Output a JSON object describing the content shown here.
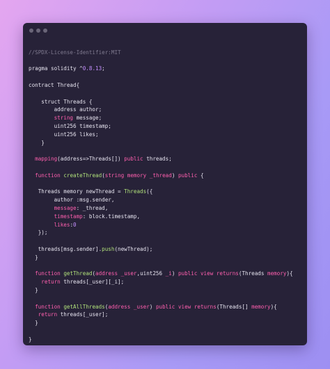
{
  "window": {
    "controls": [
      "close",
      "minimize",
      "maximize"
    ]
  },
  "code": {
    "lines": [
      [
        {
          "t": "",
          "c": "plain"
        }
      ],
      [
        {
          "t": "//SPDX-License-Identifier:MIT",
          "c": "comment"
        }
      ],
      [
        {
          "t": "",
          "c": "plain"
        }
      ],
      [
        {
          "t": "pragma solidity ^",
          "c": "plain"
        },
        {
          "t": "0.8.13",
          "c": "num"
        },
        {
          "t": ";",
          "c": "plain"
        }
      ],
      [
        {
          "t": "",
          "c": "plain"
        }
      ],
      [
        {
          "t": "contract Thread{",
          "c": "plain"
        }
      ],
      [
        {
          "t": "",
          "c": "plain"
        }
      ],
      [
        {
          "t": "    struct Threads {",
          "c": "plain"
        }
      ],
      [
        {
          "t": "        address author;",
          "c": "plain"
        }
      ],
      [
        {
          "t": "        ",
          "c": "plain"
        },
        {
          "t": "string",
          "c": "pink"
        },
        {
          "t": " message;",
          "c": "plain"
        }
      ],
      [
        {
          "t": "        uint256 timestamp;",
          "c": "plain"
        }
      ],
      [
        {
          "t": "        uint256 likes;",
          "c": "plain"
        }
      ],
      [
        {
          "t": "    }",
          "c": "plain"
        }
      ],
      [
        {
          "t": "",
          "c": "plain"
        }
      ],
      [
        {
          "t": "  ",
          "c": "plain"
        },
        {
          "t": "mapping",
          "c": "pink"
        },
        {
          "t": "(address=>Threads[]) ",
          "c": "plain"
        },
        {
          "t": "public",
          "c": "pink"
        },
        {
          "t": " threads;",
          "c": "plain"
        }
      ],
      [
        {
          "t": "",
          "c": "plain"
        }
      ],
      [
        {
          "t": "  ",
          "c": "plain"
        },
        {
          "t": "function",
          "c": "pink"
        },
        {
          "t": " ",
          "c": "plain"
        },
        {
          "t": "createThread",
          "c": "fn"
        },
        {
          "t": "(",
          "c": "plain"
        },
        {
          "t": "string",
          "c": "pink"
        },
        {
          "t": " ",
          "c": "plain"
        },
        {
          "t": "memory",
          "c": "pink"
        },
        {
          "t": " ",
          "c": "plain"
        },
        {
          "t": "_thread",
          "c": "pink"
        },
        {
          "t": ") ",
          "c": "plain"
        },
        {
          "t": "public",
          "c": "pink"
        },
        {
          "t": " {",
          "c": "plain"
        }
      ],
      [
        {
          "t": "",
          "c": "plain"
        }
      ],
      [
        {
          "t": "   Threads memory newThread = ",
          "c": "plain"
        },
        {
          "t": "Threads",
          "c": "fn"
        },
        {
          "t": "({",
          "c": "plain"
        }
      ],
      [
        {
          "t": "        author :msg.sender,",
          "c": "plain"
        }
      ],
      [
        {
          "t": "        ",
          "c": "plain"
        },
        {
          "t": "message",
          "c": "pink"
        },
        {
          "t": ": _thread,",
          "c": "plain"
        }
      ],
      [
        {
          "t": "        ",
          "c": "plain"
        },
        {
          "t": "timestamp",
          "c": "pink"
        },
        {
          "t": ": block.timestamp,",
          "c": "plain"
        }
      ],
      [
        {
          "t": "        ",
          "c": "plain"
        },
        {
          "t": "likes",
          "c": "pink"
        },
        {
          "t": ":",
          "c": "plain"
        },
        {
          "t": "0",
          "c": "num"
        }
      ],
      [
        {
          "t": "   });",
          "c": "plain"
        }
      ],
      [
        {
          "t": "",
          "c": "plain"
        }
      ],
      [
        {
          "t": "   threads[msg.sender].",
          "c": "plain"
        },
        {
          "t": "push",
          "c": "fn"
        },
        {
          "t": "(newThread);",
          "c": "plain"
        }
      ],
      [
        {
          "t": "  }",
          "c": "plain"
        }
      ],
      [
        {
          "t": "",
          "c": "plain"
        }
      ],
      [
        {
          "t": "  ",
          "c": "plain"
        },
        {
          "t": "function",
          "c": "pink"
        },
        {
          "t": " ",
          "c": "plain"
        },
        {
          "t": "getThread",
          "c": "fn"
        },
        {
          "t": "(",
          "c": "plain"
        },
        {
          "t": "address",
          "c": "pink"
        },
        {
          "t": " ",
          "c": "plain"
        },
        {
          "t": "_user",
          "c": "pink"
        },
        {
          "t": ",uint256 ",
          "c": "plain"
        },
        {
          "t": "_i",
          "c": "pink"
        },
        {
          "t": ") ",
          "c": "plain"
        },
        {
          "t": "public",
          "c": "pink"
        },
        {
          "t": " ",
          "c": "plain"
        },
        {
          "t": "view",
          "c": "pink"
        },
        {
          "t": " ",
          "c": "plain"
        },
        {
          "t": "returns",
          "c": "pink"
        },
        {
          "t": "(Threads ",
          "c": "plain"
        },
        {
          "t": "memory",
          "c": "pink"
        },
        {
          "t": "){",
          "c": "plain"
        }
      ],
      [
        {
          "t": "    ",
          "c": "plain"
        },
        {
          "t": "return",
          "c": "pink"
        },
        {
          "t": " threads[_user][_i];",
          "c": "plain"
        }
      ],
      [
        {
          "t": "  }",
          "c": "plain"
        }
      ],
      [
        {
          "t": "",
          "c": "plain"
        }
      ],
      [
        {
          "t": "  ",
          "c": "plain"
        },
        {
          "t": "function",
          "c": "pink"
        },
        {
          "t": " ",
          "c": "plain"
        },
        {
          "t": "getAllThreads",
          "c": "fn"
        },
        {
          "t": "(",
          "c": "plain"
        },
        {
          "t": "address",
          "c": "pink"
        },
        {
          "t": " ",
          "c": "plain"
        },
        {
          "t": "_user",
          "c": "pink"
        },
        {
          "t": ") ",
          "c": "plain"
        },
        {
          "t": "public",
          "c": "pink"
        },
        {
          "t": " ",
          "c": "plain"
        },
        {
          "t": "view",
          "c": "pink"
        },
        {
          "t": " ",
          "c": "plain"
        },
        {
          "t": "returns",
          "c": "pink"
        },
        {
          "t": "(Threads[] ",
          "c": "plain"
        },
        {
          "t": "memory",
          "c": "pink"
        },
        {
          "t": "){",
          "c": "plain"
        }
      ],
      [
        {
          "t": "   ",
          "c": "plain"
        },
        {
          "t": "return",
          "c": "pink"
        },
        {
          "t": " threads[_user];",
          "c": "plain"
        }
      ],
      [
        {
          "t": "  }",
          "c": "plain"
        }
      ],
      [
        {
          "t": "",
          "c": "plain"
        }
      ],
      [
        {
          "t": "}",
          "c": "plain"
        }
      ]
    ]
  }
}
